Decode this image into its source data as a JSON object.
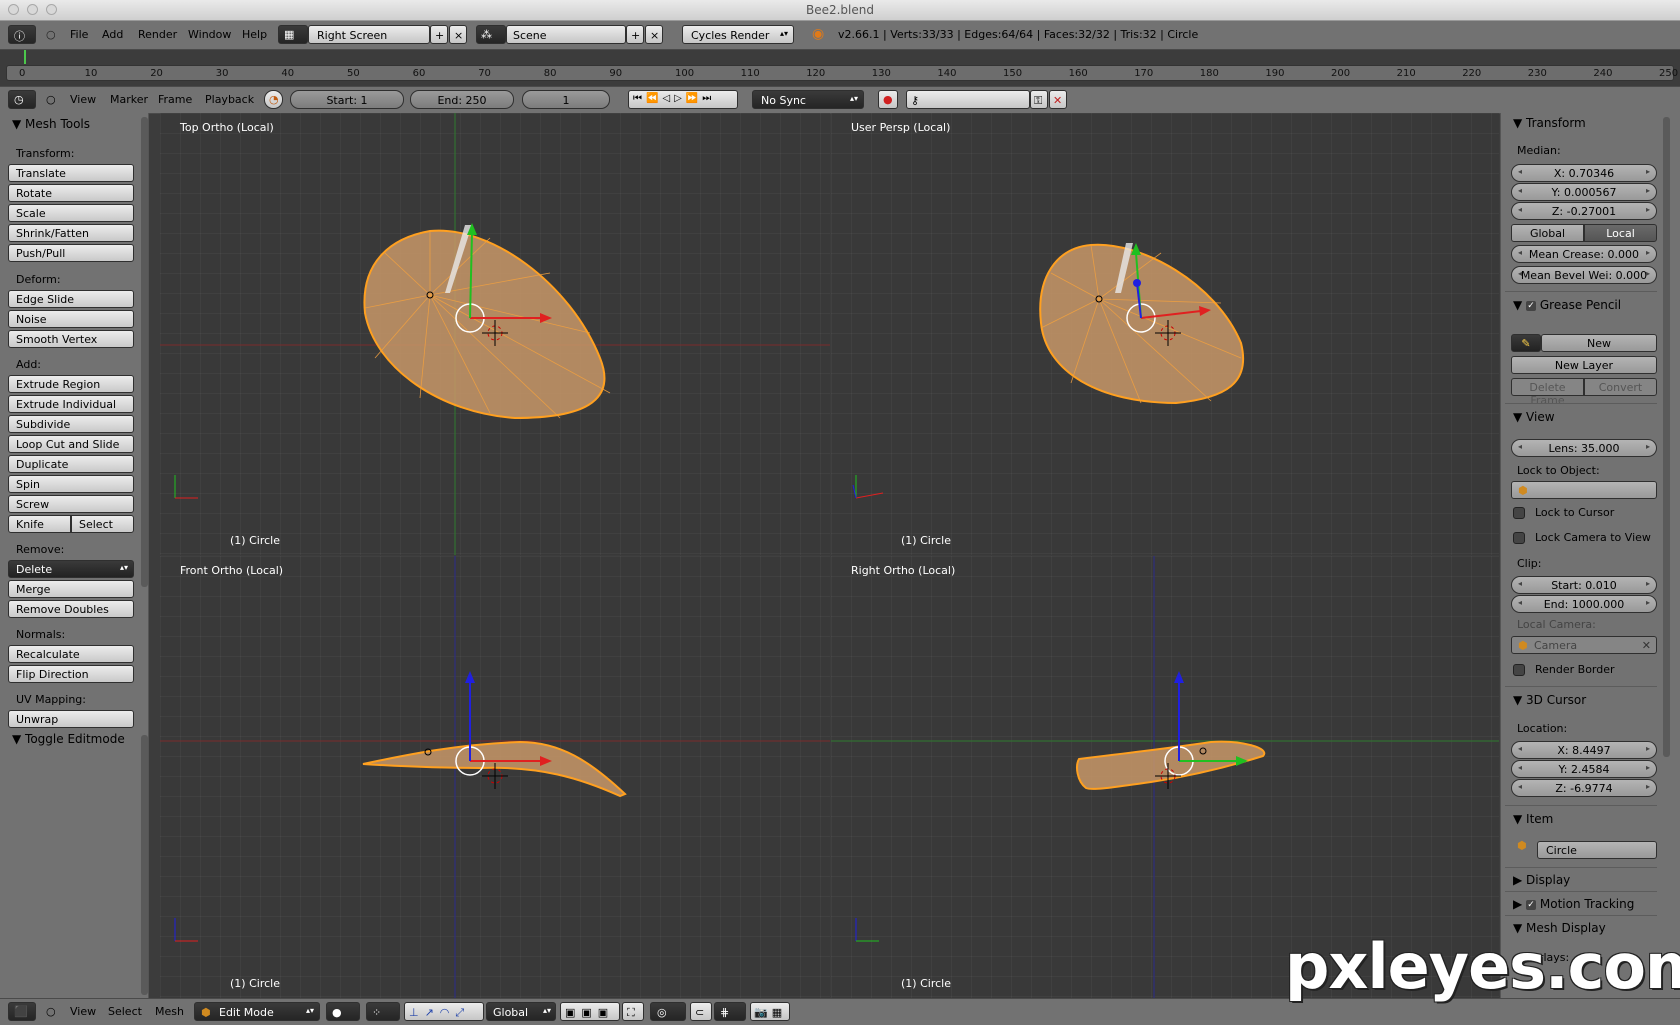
{
  "window": {
    "title": "Bee2.blend"
  },
  "info_header": {
    "menus": [
      "File",
      "Add",
      "Render",
      "Window",
      "Help"
    ],
    "screen_layout": "Right Screen",
    "scene": "Scene",
    "render_engine": "Cycles Render",
    "stats": "v2.66.1 | Verts:33/33 | Edges:64/64 | Faces:32/32 | Tris:32 | Circle"
  },
  "timeline": {
    "ticks": [
      "0",
      "10",
      "20",
      "30",
      "40",
      "50",
      "60",
      "70",
      "80",
      "90",
      "100",
      "110",
      "120",
      "130",
      "140",
      "150",
      "160",
      "170",
      "180",
      "190",
      "200",
      "210",
      "220",
      "230",
      "240",
      "250"
    ],
    "menus": [
      "View",
      "Marker",
      "Frame",
      "Playback"
    ],
    "start": "Start: 1",
    "end": "End: 250",
    "current": "1",
    "sync": "No Sync"
  },
  "toolshelf": {
    "title": "Mesh Tools",
    "transform_label": "Transform:",
    "transform": [
      "Translate",
      "Rotate",
      "Scale",
      "Shrink/Fatten",
      "Push/Pull"
    ],
    "deform_label": "Deform:",
    "deform": [
      "Edge Slide",
      "Noise",
      "Smooth Vertex"
    ],
    "add_label": "Add:",
    "add": [
      "Extrude Region",
      "Extrude Individual",
      "Subdivide",
      "Loop Cut and Slide",
      "Duplicate",
      "Spin",
      "Screw"
    ],
    "knife": "Knife",
    "select": "Select",
    "remove_label": "Remove:",
    "delete": "Delete",
    "remove": [
      "Merge",
      "Remove Doubles"
    ],
    "normals_label": "Normals:",
    "normals": [
      "Recalculate",
      "Flip Direction"
    ],
    "uv_label": "UV Mapping:",
    "unwrap": "Unwrap",
    "toggle_editmode": "Toggle Editmode"
  },
  "viewports": {
    "top_left": {
      "label": "Top Ortho (Local)",
      "object": "(1) Circle"
    },
    "top_right": {
      "label": "User Persp (Local)",
      "object": "(1) Circle"
    },
    "bottom_left": {
      "label": "Front Ortho (Local)",
      "object": "(1) Circle"
    },
    "bottom_right": {
      "label": "Right Ortho (Local)",
      "object": "(1) Circle"
    }
  },
  "properties": {
    "transform_title": "Transform",
    "median_label": "Median:",
    "x": "X: 0.70346",
    "y": "Y: 0.000567",
    "z": "Z: -0.27001",
    "global": "Global",
    "local": "Local",
    "mean_crease": "Mean Crease: 0.000",
    "mean_bevel": "Mean Bevel Wei: 0.000",
    "grease_title": "Grease Pencil",
    "new": "New",
    "new_layer": "New Layer",
    "delete_frame": "Delete Frame",
    "convert": "Convert",
    "view_title": "View",
    "lens": "Lens: 35.000",
    "lock_object_label": "Lock to Object:",
    "lock_cursor": "Lock to Cursor",
    "lock_camera": "Lock Camera to View",
    "clip_label": "Clip:",
    "clip_start": "Start: 0.010",
    "clip_end": "End: 1000.000",
    "local_camera_label": "Local Camera:",
    "camera": "Camera",
    "render_border": "Render Border",
    "cursor_title": "3D Cursor",
    "location_label": "Location:",
    "cx": "X: 8.4497",
    "cy": "Y: 2.4584",
    "cz": "Z: -6.9774",
    "item_title": "Item",
    "item_name": "Circle",
    "display_title": "Display",
    "motion_title": "Motion Tracking",
    "mesh_display_title": "Mesh Display",
    "overlays_label": "Overlays:"
  },
  "bottom_header": {
    "menus": [
      "View",
      "Select",
      "Mesh"
    ],
    "mode": "Edit Mode",
    "orientation": "Global"
  },
  "watermark": "pxleyes.com",
  "colors": {
    "mesh": "#f0a040",
    "selected_edge": "#ff9a00",
    "x_axis": "#e02020",
    "y_axis": "#20c020",
    "z_axis": "#2020e0"
  }
}
